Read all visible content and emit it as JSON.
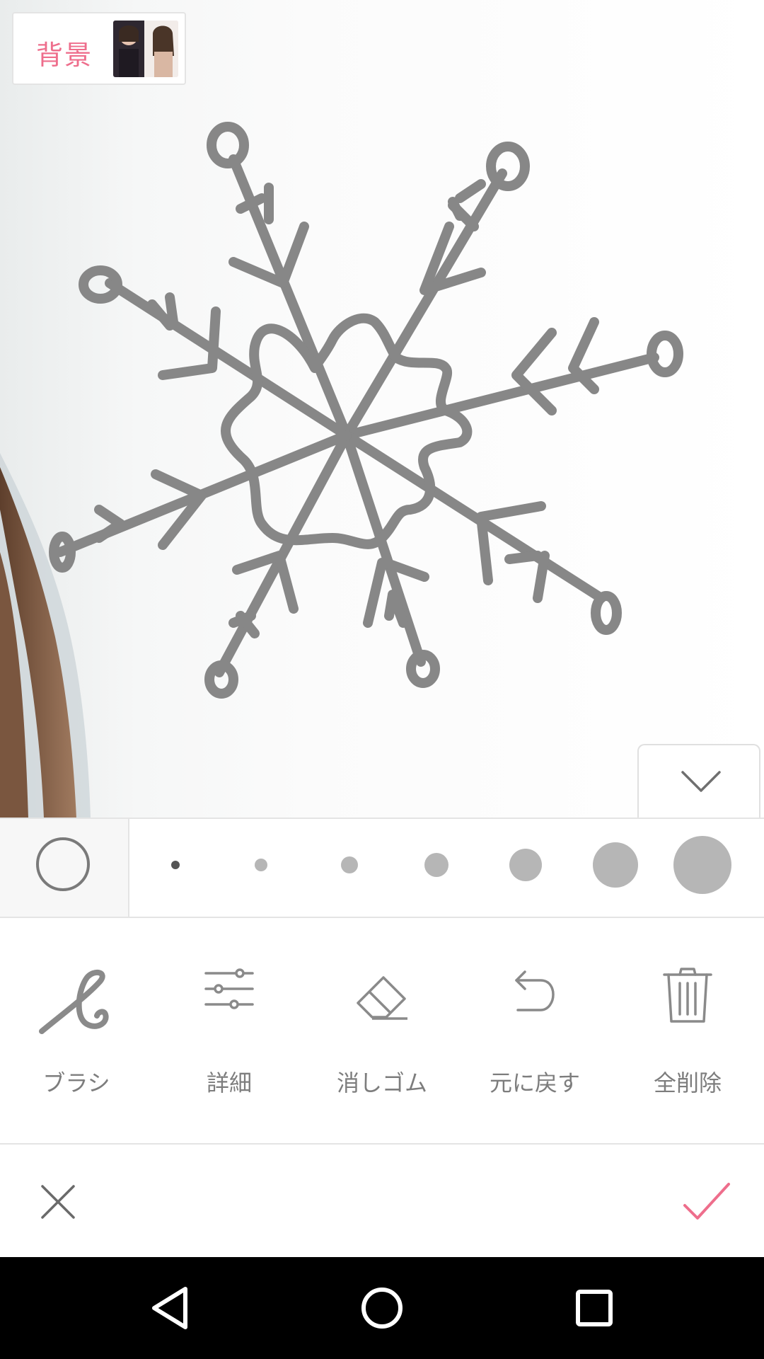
{
  "background_chip": {
    "label": "背景",
    "thumbnail_icon": "photo-thumbnail"
  },
  "canvas": {
    "drawing": "snowflake-doodle",
    "stroke_color": "#878787"
  },
  "collapse": {
    "icon": "chevron-down-icon"
  },
  "brush_sizes": {
    "selected_color": "#ffffff",
    "sizes": [
      "xs",
      "s",
      "m",
      "l",
      "xl",
      "xxl",
      "xxxl"
    ]
  },
  "tools": [
    {
      "id": "brush",
      "label": "ブラシ",
      "icon": "brush-icon"
    },
    {
      "id": "detail",
      "label": "詳細",
      "icon": "sliders-icon"
    },
    {
      "id": "eraser",
      "label": "消しゴム",
      "icon": "eraser-icon"
    },
    {
      "id": "undo",
      "label": "元に戻す",
      "icon": "undo-icon"
    },
    {
      "id": "clear",
      "label": "全削除",
      "icon": "trash-icon"
    }
  ],
  "actions": {
    "cancel_icon": "close-icon",
    "confirm_icon": "check-icon",
    "accent": "#ee6e8c"
  },
  "navbar": {
    "back_icon": "back-triangle-icon",
    "home_icon": "home-circle-icon",
    "recents_icon": "recents-square-icon"
  }
}
